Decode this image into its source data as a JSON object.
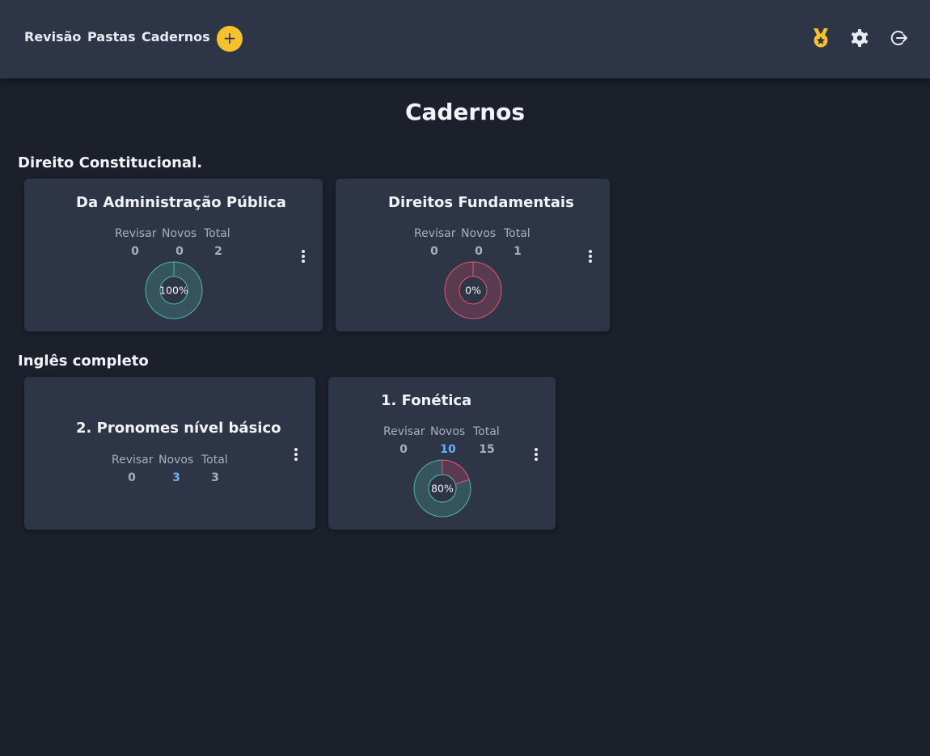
{
  "nav": {
    "revisao": "Revisão",
    "pastas": "Pastas",
    "cadernos": "Cadernos",
    "add": "+"
  },
  "page": {
    "title": "Cadernos"
  },
  "labels": {
    "revisar": "Revisar",
    "novos": "Novos",
    "total": "Total"
  },
  "folders": [
    {
      "name": "Direito Constitucional.",
      "notebooks": [
        {
          "title": "Da Administração Pública",
          "revisar": "0",
          "novos": "0",
          "total": "2",
          "percent": "100%",
          "progress": 1.0
        },
        {
          "title": "Direitos Fundamentais",
          "revisar": "0",
          "novos": "0",
          "total": "1",
          "percent": "0%",
          "progress": 0.0
        }
      ]
    },
    {
      "name": "Inglês completo",
      "notebooks": [
        {
          "title": "2. Pronomes nível básico",
          "revisar": "0",
          "novos": "3",
          "total": "3"
        },
        {
          "title": "1. Fonética",
          "revisar": "0",
          "novos": "10",
          "total": "15",
          "percent": "80%",
          "progress": 0.8
        }
      ]
    }
  ],
  "colors": {
    "accent": "#f6c12f",
    "good": "#4db6ac",
    "bad": "#e0566f",
    "blue": "#6aaef5"
  }
}
